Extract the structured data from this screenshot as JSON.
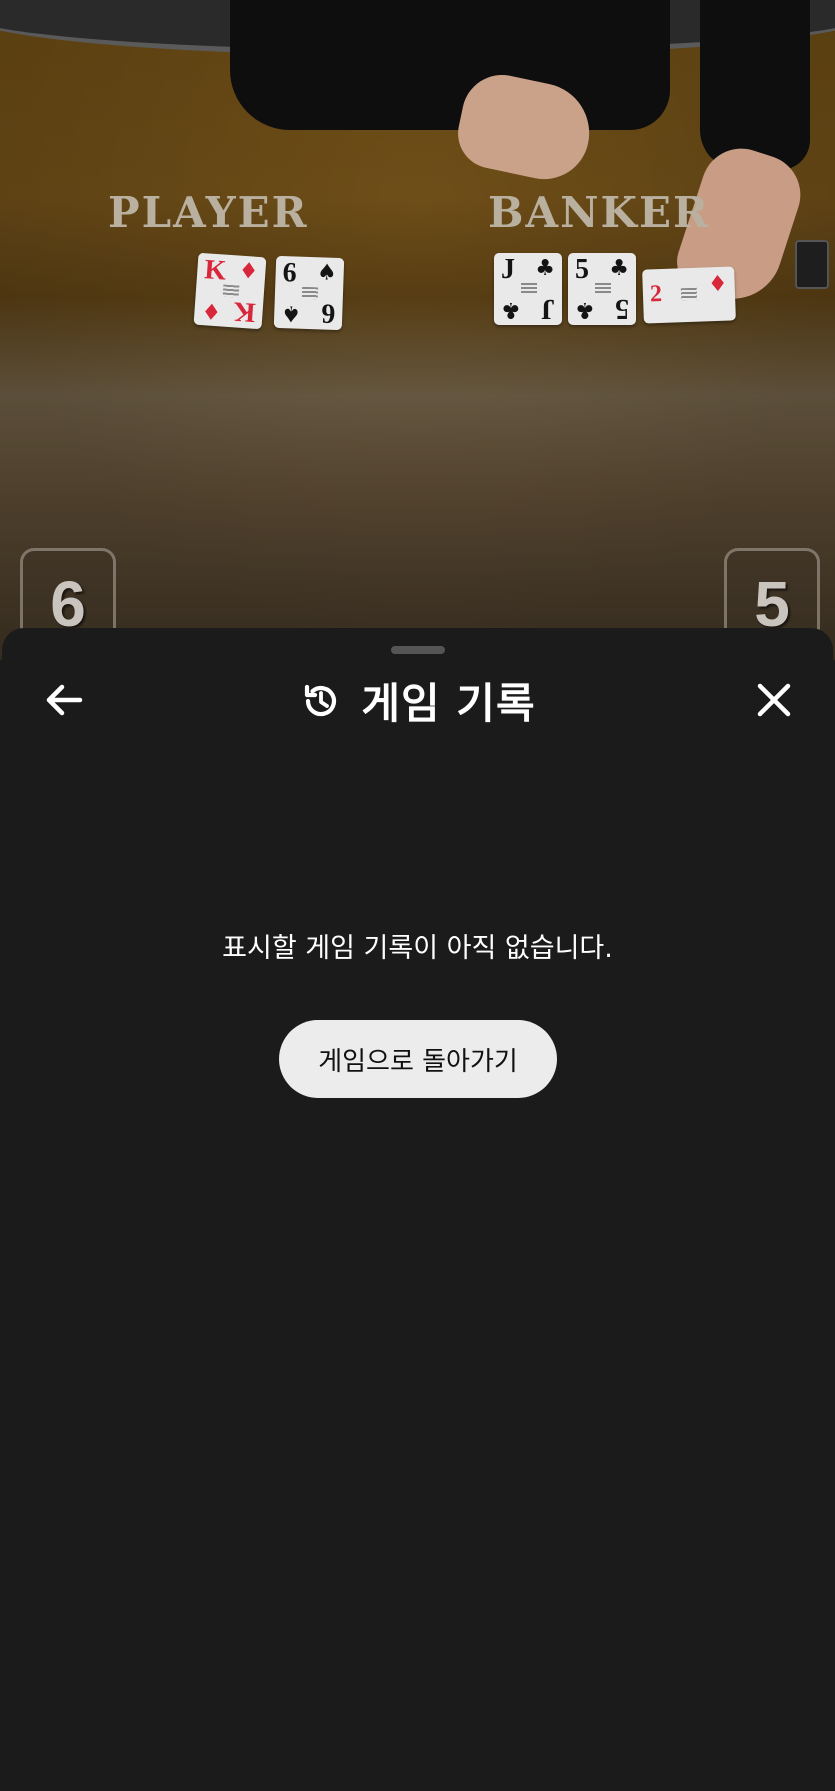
{
  "background": {
    "table_labels": {
      "player": "PLAYER",
      "banker": "BANKER"
    },
    "player_cards": [
      {
        "rank": "K",
        "suit": "♦",
        "color": "red"
      },
      {
        "rank": "6",
        "suit": "♠",
        "color": "black"
      }
    ],
    "banker_cards": [
      {
        "rank": "J",
        "suit": "♣",
        "color": "black"
      },
      {
        "rank": "5",
        "suit": "♣",
        "color": "black"
      },
      {
        "rank": "2",
        "suit": "♦",
        "color": "red"
      }
    ],
    "player_score": "6",
    "banker_score": "5"
  },
  "sheet": {
    "title": "게임 기록",
    "title_icon": "history-icon",
    "back_icon": "arrow-left-icon",
    "close_icon": "close-icon",
    "empty_message": "표시할 게임 기록이 아직 없습니다.",
    "return_button_label": "게임으로 돌아가기"
  },
  "colors": {
    "sheet_background": "#1b1b1b",
    "button_background": "#ececec",
    "text_primary": "#ffffff"
  }
}
